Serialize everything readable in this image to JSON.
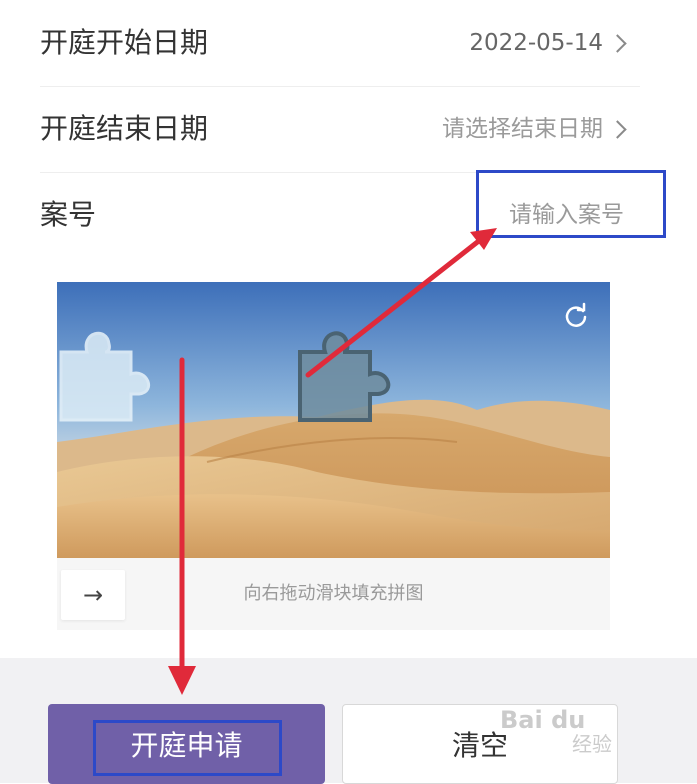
{
  "form": {
    "rows": [
      {
        "label": "开庭开始日期",
        "value": "2022-05-14"
      },
      {
        "label": "开庭结束日期",
        "value": "请选择结束日期"
      },
      {
        "label": "案号",
        "placeholder": "请输入案号"
      }
    ]
  },
  "captcha": {
    "hint": "向右拖动滑块填充拼图",
    "handle_icon": "→",
    "refresh_icon": "refresh-icon"
  },
  "buttons": {
    "submit_label": "开庭申请",
    "clear_label": "清空"
  },
  "watermark": {
    "text": "Bai du",
    "sub": "经验"
  },
  "colors": {
    "primary": "#7060a8",
    "highlight": "#2d49c8",
    "arrow": "#e02a3a"
  }
}
